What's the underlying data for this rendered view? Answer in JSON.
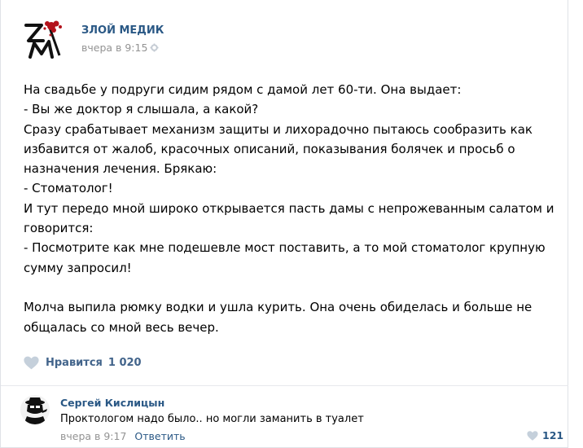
{
  "post": {
    "author": "ЗЛОЙ МЕДИК",
    "time": "вчера в 9:15",
    "time_icon": "gear-icon",
    "text_lines": [
      "На свадьбе у подруги сидим рядом с дамой лет 60-ти. Она выдает:",
      "- Вы же доктор я слышала, а какой?",
      "Сразу срабатывает механизм защиты и лихорадочно пытаюсь сообразить как",
      "избавится от жалоб, красочных описаний, показывания болячек и просьб о",
      "назначения лечения. Брякаю:",
      "- Стоматолог!",
      "И тут передо мной широко открывается пасть дамы с непрожеванным салатом и",
      "говорится:",
      "- Посмотрите как мне подешевле мост поставить, а то мой стоматолог крупную",
      "сумму запросил!",
      "",
      "Молча выпила рюмку водки и ушла курить. Она очень обиделась и больше не",
      "общалась со мной весь вечер."
    ],
    "like_label": "Нравится",
    "like_count": "1 020"
  },
  "comment": {
    "author": "Сергей Кислицын",
    "text": "Проктологом надо было.. но могли заманить в туалет",
    "time": "вчера в 9:17",
    "reply_label": "Ответить",
    "like_count": "121"
  },
  "colors": {
    "link": "#2a5885",
    "meta": "#939393",
    "heart": "#c5d0db",
    "logo_red": "#b3121b"
  }
}
